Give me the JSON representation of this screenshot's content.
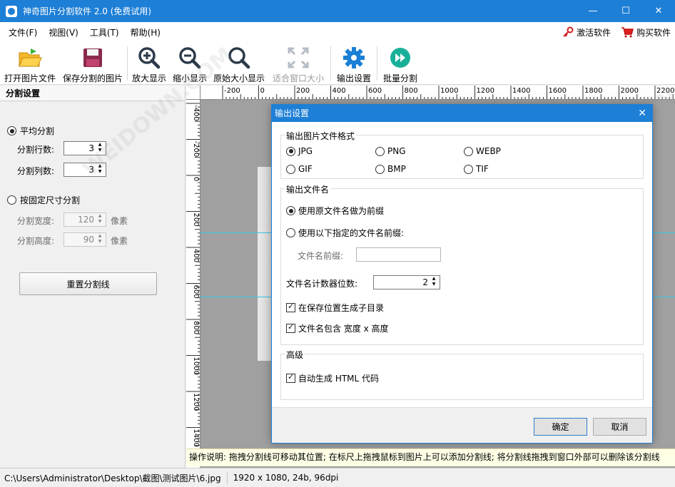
{
  "window": {
    "title": "神奇图片分割软件 2.0 (免费试用)",
    "minimize": "—",
    "maximize": "☐",
    "close": "✕"
  },
  "menu": {
    "items": [
      "文件(F)",
      "视图(V)",
      "工具(T)",
      "帮助(H)"
    ],
    "activate": "激活软件",
    "buy": "购买软件"
  },
  "toolbar": {
    "open": "打开图片文件",
    "save": "保存分割的图片",
    "zoom_in": "放大显示",
    "zoom_out": "缩小显示",
    "original": "原始大小显示",
    "fit": "适合窗口大小",
    "output_settings": "输出设置",
    "batch": "批量分割"
  },
  "left_panel": {
    "title": "分割设置",
    "even_split": "平均分割",
    "rows_label": "分割行数:",
    "rows_value": "3",
    "cols_label": "分割列数:",
    "cols_value": "3",
    "fixed_split": "按固定尺寸分割",
    "width_label": "分割宽度:",
    "width_value": "120",
    "width_unit": "像素",
    "height_label": "分割高度:",
    "height_value": "90",
    "height_unit": "像素",
    "reset_button": "重置分割线"
  },
  "ruler": {
    "top_labels": [
      "-200",
      "0",
      "200",
      "400",
      "600",
      "800",
      "1000",
      "1200",
      "1400",
      "1600",
      "1800",
      "2000",
      "2200"
    ],
    "left_labels": [
      "-400",
      "-200",
      "0",
      "200",
      "400",
      "600",
      "800",
      "1000",
      "1200",
      "1400"
    ]
  },
  "dialog": {
    "title": "输出设置",
    "close": "✕",
    "format_group": "输出图片文件格式",
    "formats": [
      "JPG",
      "PNG",
      "WEBP",
      "GIF",
      "BMP",
      "TIF"
    ],
    "selected_format": "JPG",
    "filename_group": "输出文件名",
    "use_original": "使用原文件名做为前缀",
    "use_custom": "使用以下指定的文件名前缀:",
    "prefix_label": "文件名前缀:",
    "prefix_value": "",
    "counter_label": "文件名计数器位数:",
    "counter_value": "2",
    "subdir": "在保存位置生成子目录",
    "include_size": "文件名包含 宽度 x 高度",
    "advanced_group": "高级",
    "auto_html": "自动生成 HTML 代码",
    "ok": "确定",
    "cancel": "取消"
  },
  "hint": "操作说明: 拖拽分割线可移动其位置; 在标尺上拖拽鼠标到图片上可以添加分割线; 将分割线拖拽到窗口外部可以删除该分割线",
  "status": {
    "path": "C:\\Users\\Administrator\\Desktop\\截图\\测试图片\\6.jpg",
    "info": "1920 x 1080, 24b, 96dpi"
  },
  "colors": {
    "accent": "#1e7fd6",
    "guide": "#35c7e6"
  }
}
